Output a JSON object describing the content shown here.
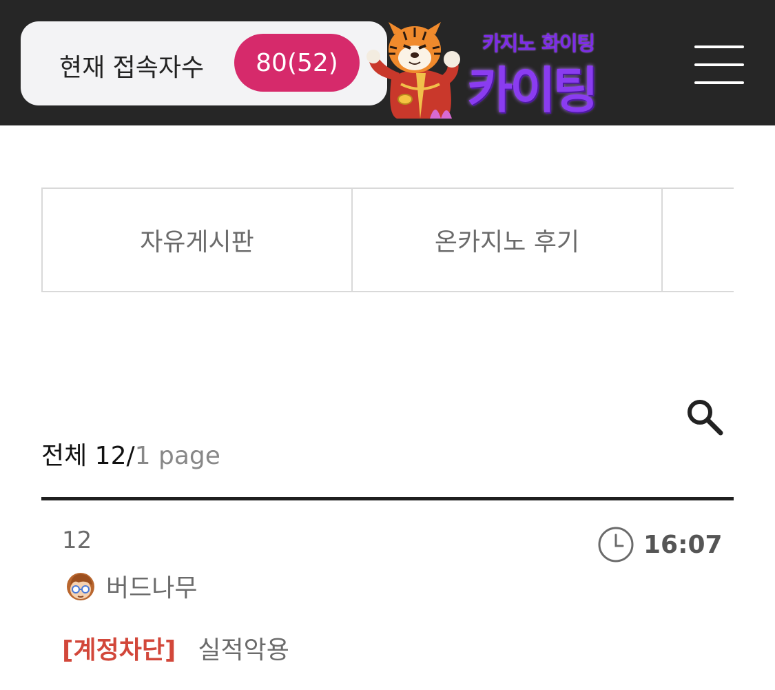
{
  "header": {
    "visitor_label": "현재 접속자수",
    "visitor_count": "80(52)",
    "logo_sub": "카지노 화이팅",
    "logo_main": "카이팅",
    "menu_icon": "hamburger-menu-icon",
    "accent_color": "#d62a6b",
    "logo_color": "#8a3cf0"
  },
  "tabs": [
    {
      "label": "자유게시판"
    },
    {
      "label": "온카지노 후기"
    },
    {
      "label": ""
    }
  ],
  "board": {
    "total_label": "전체 12/",
    "page_label": "1 page",
    "search_icon": "search-icon"
  },
  "post": {
    "number": "12",
    "time": "16:07",
    "author": "버드나무",
    "badge": "[계정차단]",
    "title": "실적악용",
    "badge_color": "#d2473a"
  }
}
